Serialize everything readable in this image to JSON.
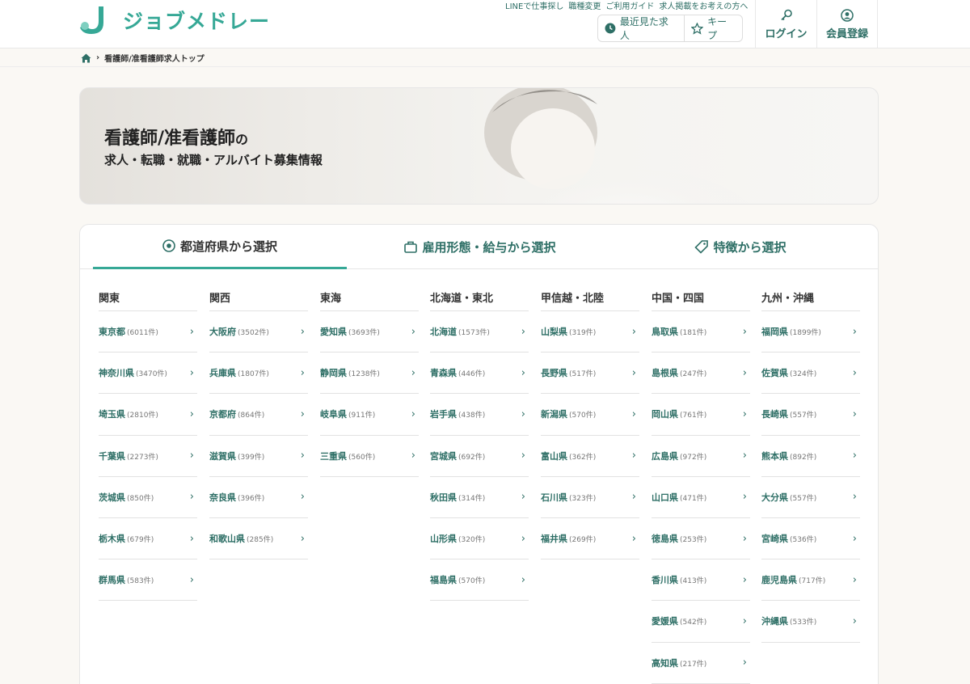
{
  "header": {
    "logo_text": "ジョブメドレー",
    "util_links": [
      "LINEで仕事探し",
      "職種変更",
      "ご利用ガイド",
      "求人掲載をお考えの方へ"
    ],
    "recent_label": "最近見た求人",
    "keep_label": "キープ",
    "login_label": "ログイン",
    "register_label": "会員登録"
  },
  "breadcrumb": {
    "current": "看護師/准看護師求人トップ"
  },
  "hero": {
    "title": "看護師/准看護師",
    "title_suffix": "の",
    "subtitle": "求人・転職・就職・アルバイト募集情報"
  },
  "tabs": [
    {
      "label": "都道府県から選択",
      "icon": "location-pin-icon",
      "active": true
    },
    {
      "label": "雇用形態・給与から選択",
      "icon": "briefcase-icon",
      "active": false
    },
    {
      "label": "特徴から選択",
      "icon": "tag-icon",
      "active": false
    }
  ],
  "regions": [
    {
      "name": "関東",
      "prefs": [
        {
          "name": "東京都",
          "count": "(6011件)"
        },
        {
          "name": "神奈川県",
          "count": "(3470件)"
        },
        {
          "name": "埼玉県",
          "count": "(2810件)"
        },
        {
          "name": "千葉県",
          "count": "(2273件)"
        },
        {
          "name": "茨城県",
          "count": "(850件)"
        },
        {
          "name": "栃木県",
          "count": "(679件)"
        },
        {
          "name": "群馬県",
          "count": "(583件)"
        }
      ]
    },
    {
      "name": "関西",
      "prefs": [
        {
          "name": "大阪府",
          "count": "(3502件)"
        },
        {
          "name": "兵庫県",
          "count": "(1807件)"
        },
        {
          "name": "京都府",
          "count": "(864件)"
        },
        {
          "name": "滋賀県",
          "count": "(399件)"
        },
        {
          "name": "奈良県",
          "count": "(396件)"
        },
        {
          "name": "和歌山県",
          "count": "(285件)"
        }
      ]
    },
    {
      "name": "東海",
      "prefs": [
        {
          "name": "愛知県",
          "count": "(3693件)"
        },
        {
          "name": "静岡県",
          "count": "(1238件)"
        },
        {
          "name": "岐阜県",
          "count": "(911件)"
        },
        {
          "name": "三重県",
          "count": "(560件)"
        }
      ]
    },
    {
      "name": "北海道・東北",
      "prefs": [
        {
          "name": "北海道",
          "count": "(1573件)"
        },
        {
          "name": "青森県",
          "count": "(446件)"
        },
        {
          "name": "岩手県",
          "count": "(438件)"
        },
        {
          "name": "宮城県",
          "count": "(692件)"
        },
        {
          "name": "秋田県",
          "count": "(314件)"
        },
        {
          "name": "山形県",
          "count": "(320件)"
        },
        {
          "name": "福島県",
          "count": "(570件)"
        }
      ]
    },
    {
      "name": "甲信越・北陸",
      "prefs": [
        {
          "name": "山梨県",
          "count": "(319件)"
        },
        {
          "name": "長野県",
          "count": "(517件)"
        },
        {
          "name": "新潟県",
          "count": "(570件)"
        },
        {
          "name": "富山県",
          "count": "(362件)"
        },
        {
          "name": "石川県",
          "count": "(323件)"
        },
        {
          "name": "福井県",
          "count": "(269件)"
        }
      ]
    },
    {
      "name": "中国・四国",
      "prefs": [
        {
          "name": "鳥取県",
          "count": "(181件)"
        },
        {
          "name": "島根県",
          "count": "(247件)"
        },
        {
          "name": "岡山県",
          "count": "(761件)"
        },
        {
          "name": "広島県",
          "count": "(972件)"
        },
        {
          "name": "山口県",
          "count": "(471件)"
        },
        {
          "name": "徳島県",
          "count": "(253件)"
        },
        {
          "name": "香川県",
          "count": "(413件)"
        },
        {
          "name": "愛媛県",
          "count": "(542件)"
        },
        {
          "name": "高知県",
          "count": "(217件)"
        }
      ]
    },
    {
      "name": "九州・沖縄",
      "prefs": [
        {
          "name": "福岡県",
          "count": "(1899件)"
        },
        {
          "name": "佐賀県",
          "count": "(324件)"
        },
        {
          "name": "長崎県",
          "count": "(557件)"
        },
        {
          "name": "熊本県",
          "count": "(892件)"
        },
        {
          "name": "大分県",
          "count": "(557件)"
        },
        {
          "name": "宮崎県",
          "count": "(536件)"
        },
        {
          "name": "鹿児島県",
          "count": "(717件)"
        },
        {
          "name": "沖縄県",
          "count": "(533件)"
        }
      ]
    }
  ],
  "colors": {
    "brand": "#36a896",
    "link": "#2e6f66"
  }
}
